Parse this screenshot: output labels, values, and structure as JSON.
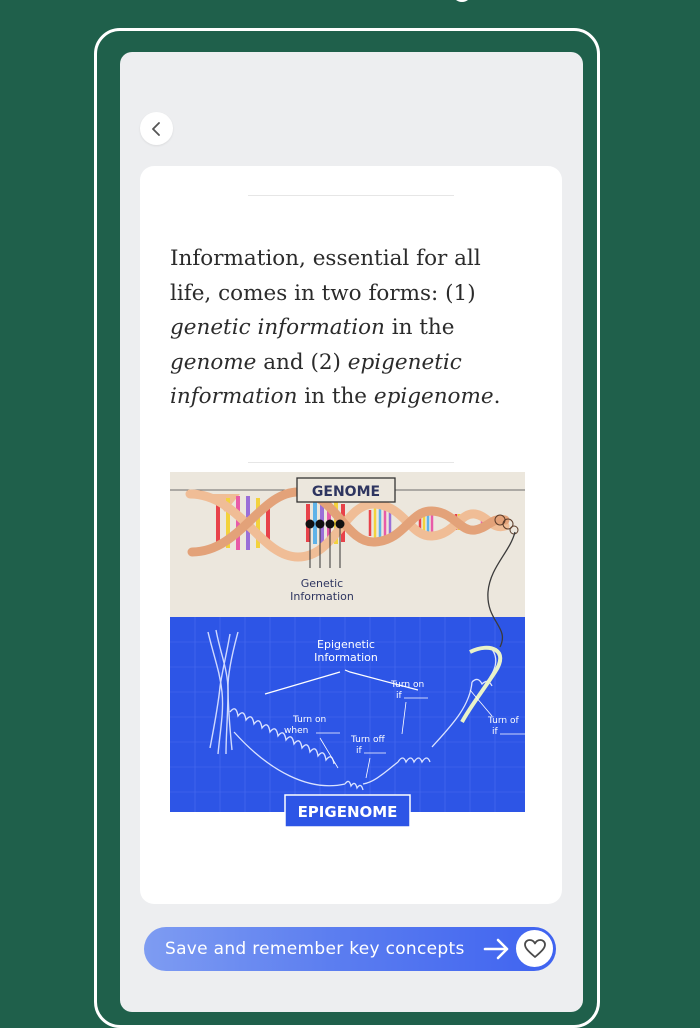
{
  "card": {
    "parts": [
      {
        "text": "Information, essential for all life, comes in two forms: (1) ",
        "italic": false
      },
      {
        "text": "genetic information",
        "italic": true
      },
      {
        "text": " in the ",
        "italic": false
      },
      {
        "text": "genome",
        "italic": true
      },
      {
        "text": " and (2) ",
        "italic": false
      },
      {
        "text": "epigenetic information",
        "italic": true
      },
      {
        "text": " in the ",
        "italic": false
      },
      {
        "text": "epigenome",
        "italic": true
      },
      {
        "text": ".",
        "italic": false
      }
    ]
  },
  "figure": {
    "genome_label": "GENOME",
    "genetic_info_line1": "Genetic",
    "genetic_info_line2": "Information",
    "epigenetic_info_line1": "Epigenetic",
    "epigenetic_info_line2": "Information",
    "turn_on_if_line1": "Turn on",
    "turn_on_if_line2": "if",
    "turn_on_when_line1": "Turn on",
    "turn_on_when_line2": "when",
    "turn_off_if_line1": "Turn off",
    "turn_off_if_line2": "if",
    "turn_of_right_line1": "Turn of",
    "turn_of_right_line2": "if",
    "epigenome_label": "EPIGENOME",
    "colors": {
      "genome_bg": "#ece7dd",
      "epigenome_bg": "#2d55e6",
      "dna_strand": "#f0bd96",
      "label_dark": "#2e3560"
    }
  },
  "save_bar": {
    "label": "Save and remember key concepts",
    "arrow_icon": "arrow-right-icon",
    "heart_icon": "heart-icon"
  },
  "nav": {
    "back_icon": "chevron-left-icon"
  }
}
